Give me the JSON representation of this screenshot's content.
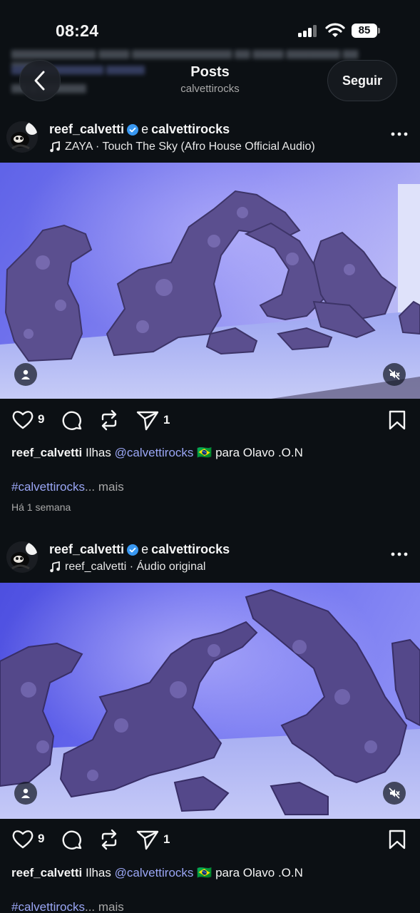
{
  "status_bar": {
    "time": "08:24",
    "battery": "85"
  },
  "header": {
    "title": "Posts",
    "subtitle": "calvettirocks",
    "follow_label": "Seguir"
  },
  "posts": [
    {
      "author": "reef_calvetti",
      "joiner": "e",
      "coauthor": "calvettirocks",
      "audio": "ZAYA · Touch The Sky (Afro House Official Audio)",
      "likes": "9",
      "shares": "1",
      "caption_user": "reef_calvetti",
      "caption_text": "Ilhas",
      "caption_mention": "@calvettirocks",
      "caption_flag": "🇧🇷",
      "caption_rest": "para Olavo .O.N",
      "hashtag": "#calvettirocks",
      "more": "... mais",
      "time": "Há 1 semana"
    },
    {
      "author": "reef_calvetti",
      "joiner": "e",
      "coauthor": "calvettirocks",
      "audio": "reef_calvetti · Áudio original",
      "likes": "9",
      "shares": "1",
      "caption_user": "reef_calvetti",
      "caption_text": "Ilhas",
      "caption_mention": "@calvettirocks",
      "caption_flag": "🇧🇷",
      "caption_rest": "para Olavo .O.N",
      "hashtag": "#calvettirocks",
      "more": "... mais"
    }
  ],
  "colors": {
    "background": "#0c1014",
    "mention": "#9aa6f5",
    "verified": "#3897f0"
  },
  "icons": [
    "chevron-left-icon",
    "verified-icon",
    "music-note-icon",
    "more-icon",
    "heart-icon",
    "comment-icon",
    "repost-icon",
    "share-icon",
    "bookmark-icon",
    "user-tag-icon",
    "muted-icon"
  ]
}
